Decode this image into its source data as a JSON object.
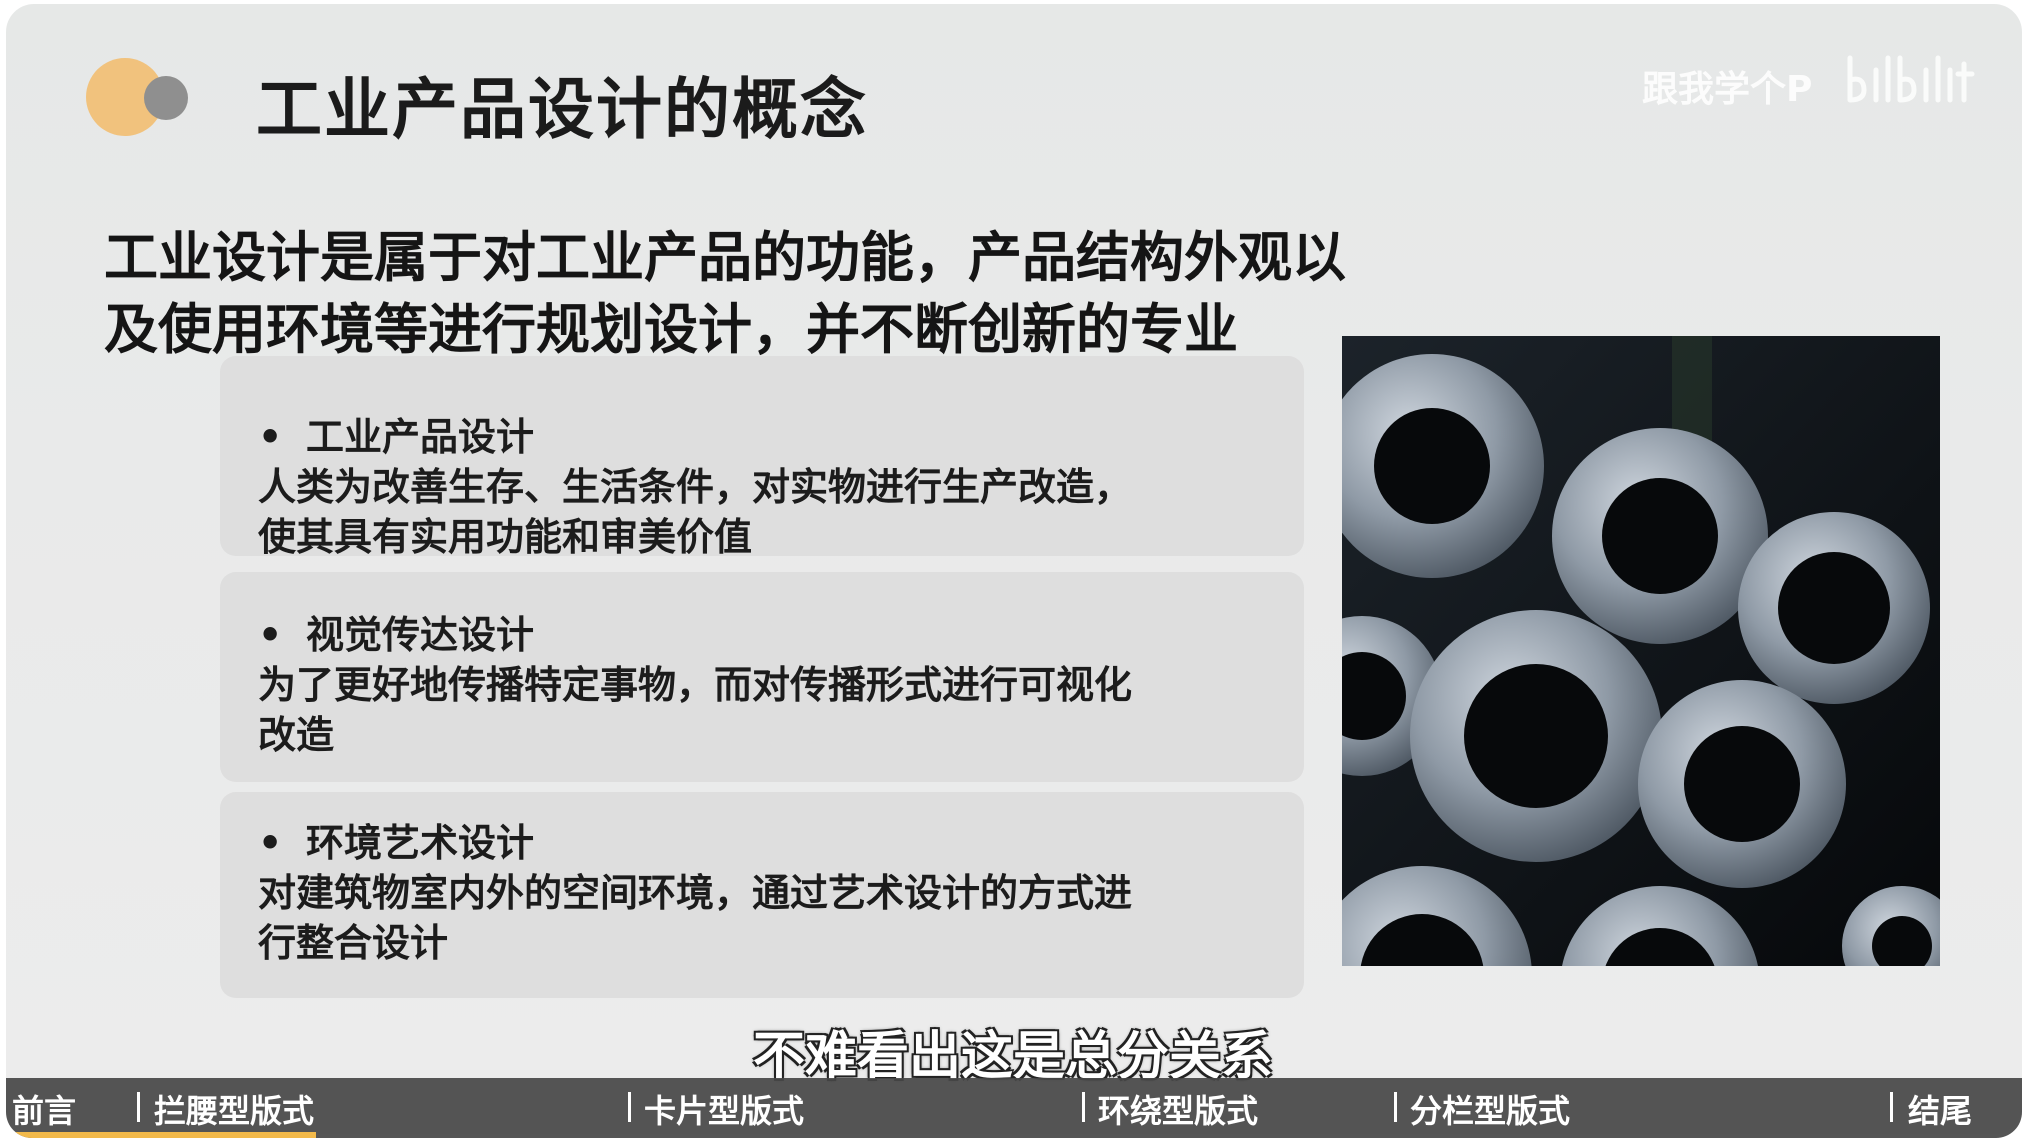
{
  "slide": {
    "title": "工业产品设计的概念",
    "watermark": "跟我学个P",
    "headline": {
      "line1": "工业设计是属于对工业产品的功能，产品结构外观以",
      "line2": "及使用环境等进行规划设计，并不断创新的专业"
    },
    "cards": [
      {
        "bullet": "•",
        "title": "工业产品设计",
        "desc_line1": "人类为改善生存、生活条件，对实物进行生产改造，",
        "desc_line2": "使其具有实用功能和审美价值"
      },
      {
        "bullet": "•",
        "title": "视觉传达设计",
        "desc_line1": "为了更好地传播特定事物，而对传播形式进行可视化",
        "desc_line2": "改造"
      },
      {
        "bullet": "•",
        "title": "环境艺术设计",
        "desc_line1": "对建筑物室内外的空间环境，通过艺术设计的方式进",
        "desc_line2": "行整合设计"
      }
    ]
  },
  "subtitle": "不难看出这是总分关系",
  "chapters": [
    {
      "label": "前言"
    },
    {
      "label": "拦腰型版式"
    },
    {
      "label": "卡片型版式"
    },
    {
      "label": "环绕型版式"
    },
    {
      "label": "分栏型版式"
    },
    {
      "label": "结尾"
    }
  ],
  "colors": {
    "accent_orange": "#f1c27d",
    "accent_gray": "#8f8f8f",
    "progress": "#f2b94a",
    "card_bg": "#dedede"
  },
  "icons": {
    "photo": "metal-pipes-photo",
    "logo": "bilibili-logo"
  }
}
